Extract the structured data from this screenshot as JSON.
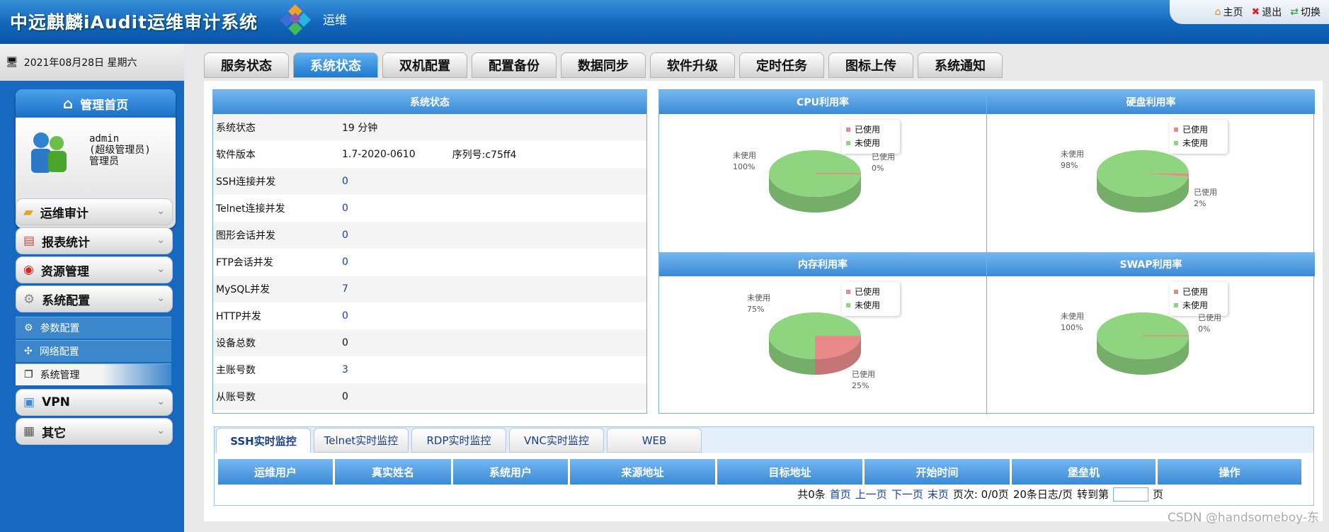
{
  "header": {
    "title": "中远麒麟iAudit运维审计系统",
    "module": "运维"
  },
  "topnav": [
    {
      "label": "主页",
      "icon": "home-icon"
    },
    {
      "label": "退出",
      "icon": "exit-icon"
    },
    {
      "label": "切换",
      "icon": "switch-icon"
    }
  ],
  "sidebar": {
    "date": "2021年08月28日 星期六",
    "home_label": "管理首页",
    "user": {
      "name": "admin",
      "role": "(超级管理员)",
      "title": "管理员"
    },
    "menu": [
      {
        "label": "运维审计"
      },
      {
        "label": "报表统计"
      },
      {
        "label": "资源管理"
      },
      {
        "label": "系统配置"
      }
    ],
    "submenu": [
      {
        "label": "参数配置"
      },
      {
        "label": "网络配置"
      },
      {
        "label": "系统管理"
      }
    ],
    "menu2": [
      {
        "label": "VPN"
      },
      {
        "label": "其它"
      }
    ]
  },
  "tabs": [
    "服务状态",
    "系统状态",
    "双机配置",
    "配置备份",
    "数据同步",
    "软件升级",
    "定时任务",
    "图标上传",
    "系统通知"
  ],
  "status": {
    "title": "系统状态",
    "rows": [
      {
        "key": "系统状态",
        "value": "19 分钟"
      },
      {
        "key": "软件版本",
        "value": "1.7-2020-0610",
        "serial": "序列号:c75ff4"
      },
      {
        "key": "SSH连接并发",
        "value": "0"
      },
      {
        "key": "Telnet连接并发",
        "value": "0"
      },
      {
        "key": "图形会话并发",
        "value": "0"
      },
      {
        "key": "FTP会话并发",
        "value": "0"
      },
      {
        "key": "MySQL并发",
        "value": "7"
      },
      {
        "key": "HTTP并发",
        "value": "0"
      },
      {
        "key": "设备总数",
        "value": "0"
      },
      {
        "key": "主账号数",
        "value": "3"
      },
      {
        "key": "从账号数",
        "value": "0"
      }
    ]
  },
  "legend": {
    "used": "已使用",
    "unused": "未使用"
  },
  "chart_data": [
    {
      "type": "pie",
      "title": "CPU利用率",
      "categories": [
        "已使用",
        "未使用"
      ],
      "values": [
        0,
        100
      ],
      "labels": [
        "0%",
        "100%"
      ],
      "colors": [
        "#e88a8a",
        "#8fd47f"
      ]
    },
    {
      "type": "pie",
      "title": "硬盘利用率",
      "categories": [
        "已使用",
        "未使用"
      ],
      "values": [
        2,
        98
      ],
      "labels": [
        "2%",
        "98%"
      ],
      "colors": [
        "#e88a8a",
        "#8fd47f"
      ]
    },
    {
      "type": "pie",
      "title": "内存利用率",
      "categories": [
        "已使用",
        "未使用"
      ],
      "values": [
        25,
        75
      ],
      "labels": [
        "25%",
        "75%"
      ],
      "colors": [
        "#e88a8a",
        "#8fd47f"
      ]
    },
    {
      "type": "pie",
      "title": "SWAP利用率",
      "categories": [
        "已使用",
        "未使用"
      ],
      "values": [
        0,
        100
      ],
      "labels": [
        "0%",
        "100%"
      ],
      "colors": [
        "#e88a8a",
        "#8fd47f"
      ]
    }
  ],
  "monitor": {
    "tabs": [
      "SSH实时监控",
      "Telnet实时监控",
      "RDP实时监控",
      "VNC实时监控",
      "WEB"
    ],
    "columns": [
      "运维用户",
      "真实姓名",
      "系统用户",
      "来源地址",
      "目标地址",
      "开始时间",
      "堡垒机",
      "操作"
    ],
    "pager": {
      "total": "共0条",
      "first": "首页",
      "prev": "上一页",
      "next": "下一页",
      "last": "末页",
      "pages": "页次: 0/0页",
      "per": "20条日志/页",
      "goto": "转到第",
      "suffix": "页"
    }
  },
  "watermark": "CSDN @handsomeboy-东"
}
